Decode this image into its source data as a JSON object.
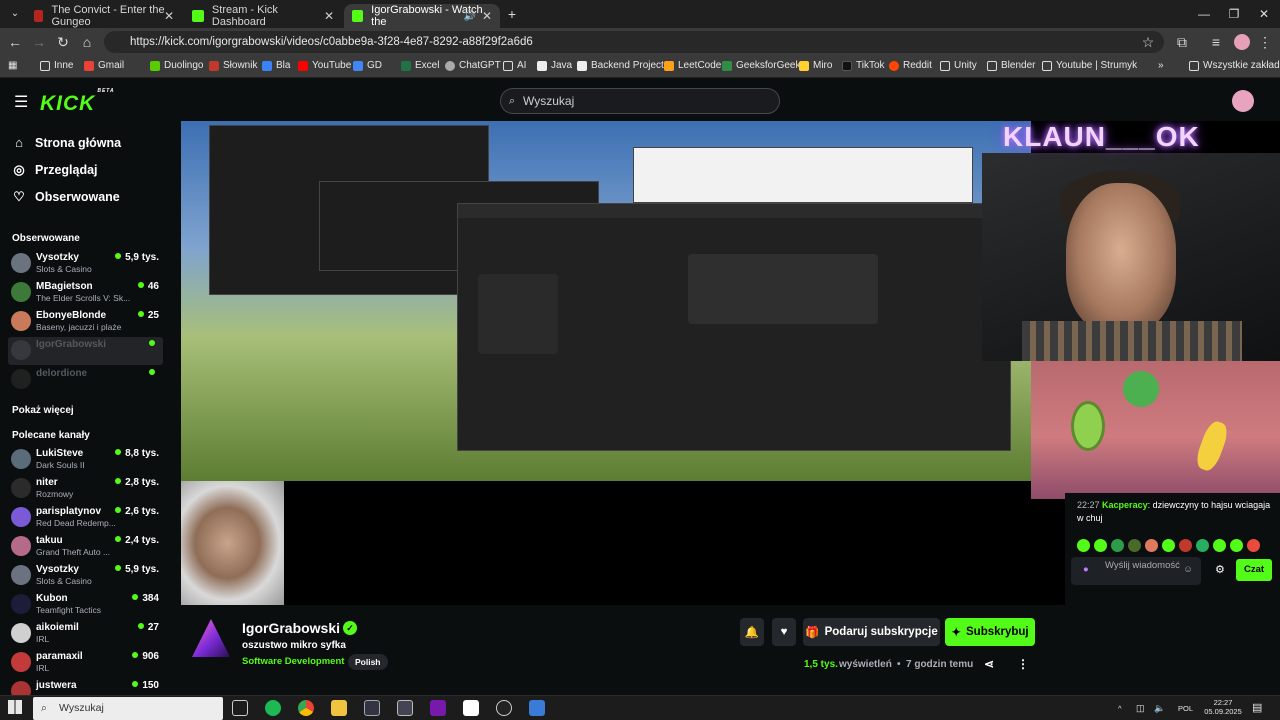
{
  "browser": {
    "tabs": [
      {
        "title": "The Convict - Enter the Gungeo",
        "favicon_color": "#b3261e",
        "active": false
      },
      {
        "title": "Stream - Kick Dashboard",
        "favicon_color": "#53fc18",
        "active": false
      },
      {
        "title": "IgorGrabowski - Watch the",
        "favicon_color": "#53fc18",
        "active": true
      }
    ],
    "new_tab": "+",
    "url": "https://kick.com/igorgrabowski/videos/c0abbe9a-3f28-4e87-8292-a88f29f2a6d6",
    "bookmarks": [
      "Inne",
      "Gmail",
      "Duolingo",
      "Słownik",
      "Bla",
      "YouTube",
      "GD",
      "Excel",
      "ChatGPT",
      "AI",
      "Java",
      "Backend Projects",
      "LeetCode",
      "GeeksforGeeks",
      "Miro",
      "TikTok",
      "Reddit",
      "Unity",
      "Blender",
      "Youtube | Strumyk"
    ],
    "bookmarks_all": "Wszystkie zakładki"
  },
  "kick": {
    "logo": "KICK",
    "logo_badge": "BETA",
    "search_placeholder": "Wyszukaj",
    "nav": [
      {
        "label": "Strona główna",
        "icon": "home-icon"
      },
      {
        "label": "Przeglądaj",
        "icon": "compass-icon"
      },
      {
        "label": "Obserwowane",
        "icon": "heart-icon"
      }
    ],
    "followed_header": "Obserwowane",
    "followed": [
      {
        "name": "Vysotzky",
        "category": "Slots & Casino",
        "viewers": "5,9 tys.",
        "color": "#6b7280"
      },
      {
        "name": "MBagietson",
        "category": "The Elder Scrolls V: Sk...",
        "viewers": "46",
        "color": "#3d7a3a"
      },
      {
        "name": "EbonyeBlonde",
        "category": "Baseny, jacuzzi i plaże",
        "viewers": "25",
        "color": "#c97a5a"
      },
      {
        "name": "IgorGrabowski",
        "category": "",
        "viewers": "",
        "color": "#4b4b55",
        "offline": true,
        "selected": true
      },
      {
        "name": "delordione",
        "category": "",
        "viewers": "",
        "color": "#333",
        "offline": true
      }
    ],
    "show_more": "Pokaż więcej",
    "recommended_header": "Polecane kanały",
    "recommended": [
      {
        "name": "LukiSteve",
        "category": "Dark Souls II",
        "viewers": "8,8 tys.",
        "color": "#5a6b7a"
      },
      {
        "name": "niter",
        "category": "Rozmowy",
        "viewers": "2,8 tys.",
        "color": "#2b2b2b"
      },
      {
        "name": "parisplatynov",
        "category": "Red Dead Redemp...",
        "viewers": "2,6 tys.",
        "color": "#7a5ad6"
      },
      {
        "name": "takuu",
        "category": "Grand Theft Auto ...",
        "viewers": "2,4 tys.",
        "color": "#b56a8a"
      },
      {
        "name": "Vysotzky",
        "category": "Slots & Casino",
        "viewers": "5,9 tys.",
        "color": "#6b7280"
      },
      {
        "name": "Kubon",
        "category": "Teamfight Tactics",
        "viewers": "384",
        "color": "#1d1d3a"
      },
      {
        "name": "aikoiemil",
        "category": "IRL",
        "viewers": "27",
        "color": "#d0d0d0"
      },
      {
        "name": "paramaxil",
        "category": "IRL",
        "viewers": "906",
        "color": "#c23a3a"
      },
      {
        "name": "justwera",
        "category": "",
        "viewers": "150",
        "color": "#a33"
      }
    ]
  },
  "video": {
    "overlay_title": "KLAUN___OK",
    "chat": {
      "time": "22:27",
      "user": "Kacperacy",
      "message": "dziewczyny to hajsu wciagaja w chuj",
      "input_placeholder": "Wyślij wiadomość",
      "send": "Czat"
    },
    "emote_colors": [
      "#53fc18",
      "#53fc18",
      "#2c9c4a",
      "#4a6a2a",
      "#e07a5f",
      "#53fc18",
      "#c0392b",
      "#27ae60",
      "#53fc18",
      "#53fc18",
      "#e74c3c",
      "#8e6d3a"
    ]
  },
  "stream": {
    "name": "IgorGrabowski",
    "verified": "✓",
    "title": "oszustwo mikro syfka",
    "category": "Software Development",
    "tag": "Polish",
    "gift_label": "Podaruj subskrypcje",
    "subscribe_label": "Subskrybuj",
    "views": "1,5 tys.",
    "views_label": "wyświetleń",
    "time_ago": "7 godzin temu",
    "separator": "•"
  },
  "taskbar": {
    "search": "Wyszukaj",
    "lang": "POL",
    "time": "22:27",
    "date": "05.09.2025"
  }
}
